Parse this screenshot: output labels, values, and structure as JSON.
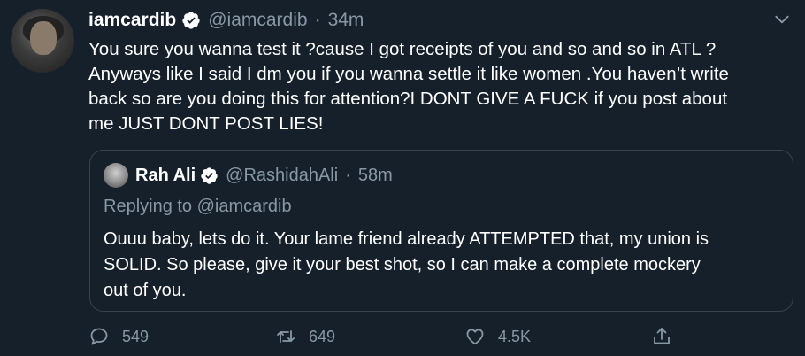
{
  "tweet": {
    "display_name": "iamcardib",
    "handle": "@iamcardib",
    "separator": "·",
    "time": "34m",
    "text": "You sure you wanna test it ?cause I got receipts of you and so and so in ATL ?\nAnyways like I said I dm you if you wanna settle it like women .You haven’t write\nback so are you doing this for attention?I DONT GIVE A FUCK if you post about\nme JUST DONT POST LIES!"
  },
  "quoted": {
    "display_name": "Rah Ali",
    "handle": "@RashidahAli",
    "separator": "·",
    "time": "58m",
    "replying_to": "Replying to @iamcardib",
    "text": "Ouuu baby, lets do it. Your lame friend already ATTEMPTED that, my union is\nSOLID. So please, give it your best shot, so I can make a complete mockery\nout of you."
  },
  "actions": {
    "replies": "549",
    "retweets": "649",
    "likes": "4.5K"
  },
  "icons": {
    "verified": "verified-badge-icon",
    "menu": "chevron-down-icon",
    "reply": "reply-icon",
    "retweet": "retweet-icon",
    "like": "heart-icon",
    "share": "share-icon"
  },
  "colors": {
    "background": "#15202b",
    "secondary_text": "#8899a6",
    "border": "#38444d"
  }
}
